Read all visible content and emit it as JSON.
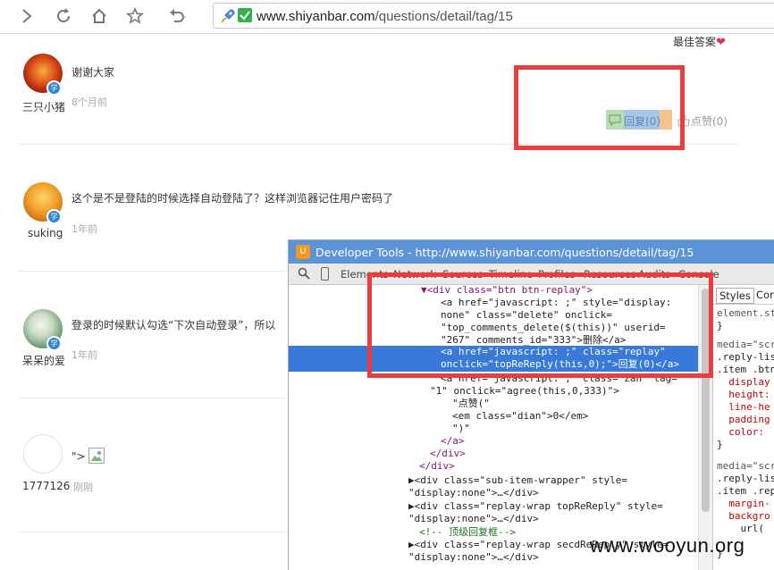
{
  "browser": {
    "url_host": "www.shiyanbar.com",
    "url_path": "/questions/detail/tag/15"
  },
  "page": {
    "best_answer": "最佳答案",
    "reply_button": "回复(0)",
    "like_button": "点赞(0)",
    "comments": [
      {
        "user": "三只小猪",
        "text": "谢谢大家",
        "time": "8个月前"
      },
      {
        "user": "suking",
        "text": "这个是不是登陆的时候选择自动登陆了？这样浏览器记住用户密码了",
        "time": "1年前"
      },
      {
        "user": "呆呆的爱",
        "text": "登录的时候默认勾选“下次自动登录”，所以",
        "time": "1年前"
      },
      {
        "user": "1777126",
        "text": "\">",
        "time": "刚刚"
      }
    ],
    "badge": "学"
  },
  "devtools": {
    "title": "Developer Tools - http://www.shiyanbar.com/questions/detail/tag/15",
    "tabs": [
      "Elements",
      "Network",
      "Sources",
      "Timeline",
      "Profiles",
      "Resources",
      "Audits",
      "Console"
    ],
    "styles_tabs": [
      "Styles",
      "Cor"
    ],
    "code_lines": [
      "▼<div class=\"btn btn-replay\">",
      "<a href=\"javascript: ;\" style=\"display:",
      "none\" class=\"delete\" onclick=",
      "\"top_comments_delete($(this))\" userid=",
      "\"267\" comments_id=\"333\">删除</a>",
      "<a href=\"javascript: ;\" class=\"replay\"",
      "onclick=\"topReReply(this,0);\">回复(0)</a>",
      "<a href=\"javascript: ;\" class=\"zan\" tag=",
      "\"1\" onclick=\"agree(this,0,333)\">",
      "\"点赞(\"",
      "<em class=\"dian\">0</em>",
      "\")\"",
      "</a>",
      "</div>",
      "</div>",
      "▶<div class=\"sub-item-wrapper\" style=",
      "\"display:none\">…</div>",
      "▶<div class=\"replay-wrap topReReply\" style=",
      "\"display:none\">…</div>",
      "<!-- 顶级回复框-->",
      "▶<div class=\"replay-wrap secdReReply\" style=",
      "\"display:none\">…</div>"
    ],
    "style_lines": [
      "element.st",
      "}",
      "",
      "media=\"scr",
      ".reply-lis",
      ".item .btn",
      "  display",
      "  height:",
      "  line-he",
      "  padding",
      "  color:",
      "}",
      "",
      "media=\"scr",
      ".reply-lis",
      ".item .rep",
      "  margin-",
      "  backgro",
      "    url(",
      "    ",
      "}"
    ]
  },
  "watermark": "www.wooyun.org"
}
